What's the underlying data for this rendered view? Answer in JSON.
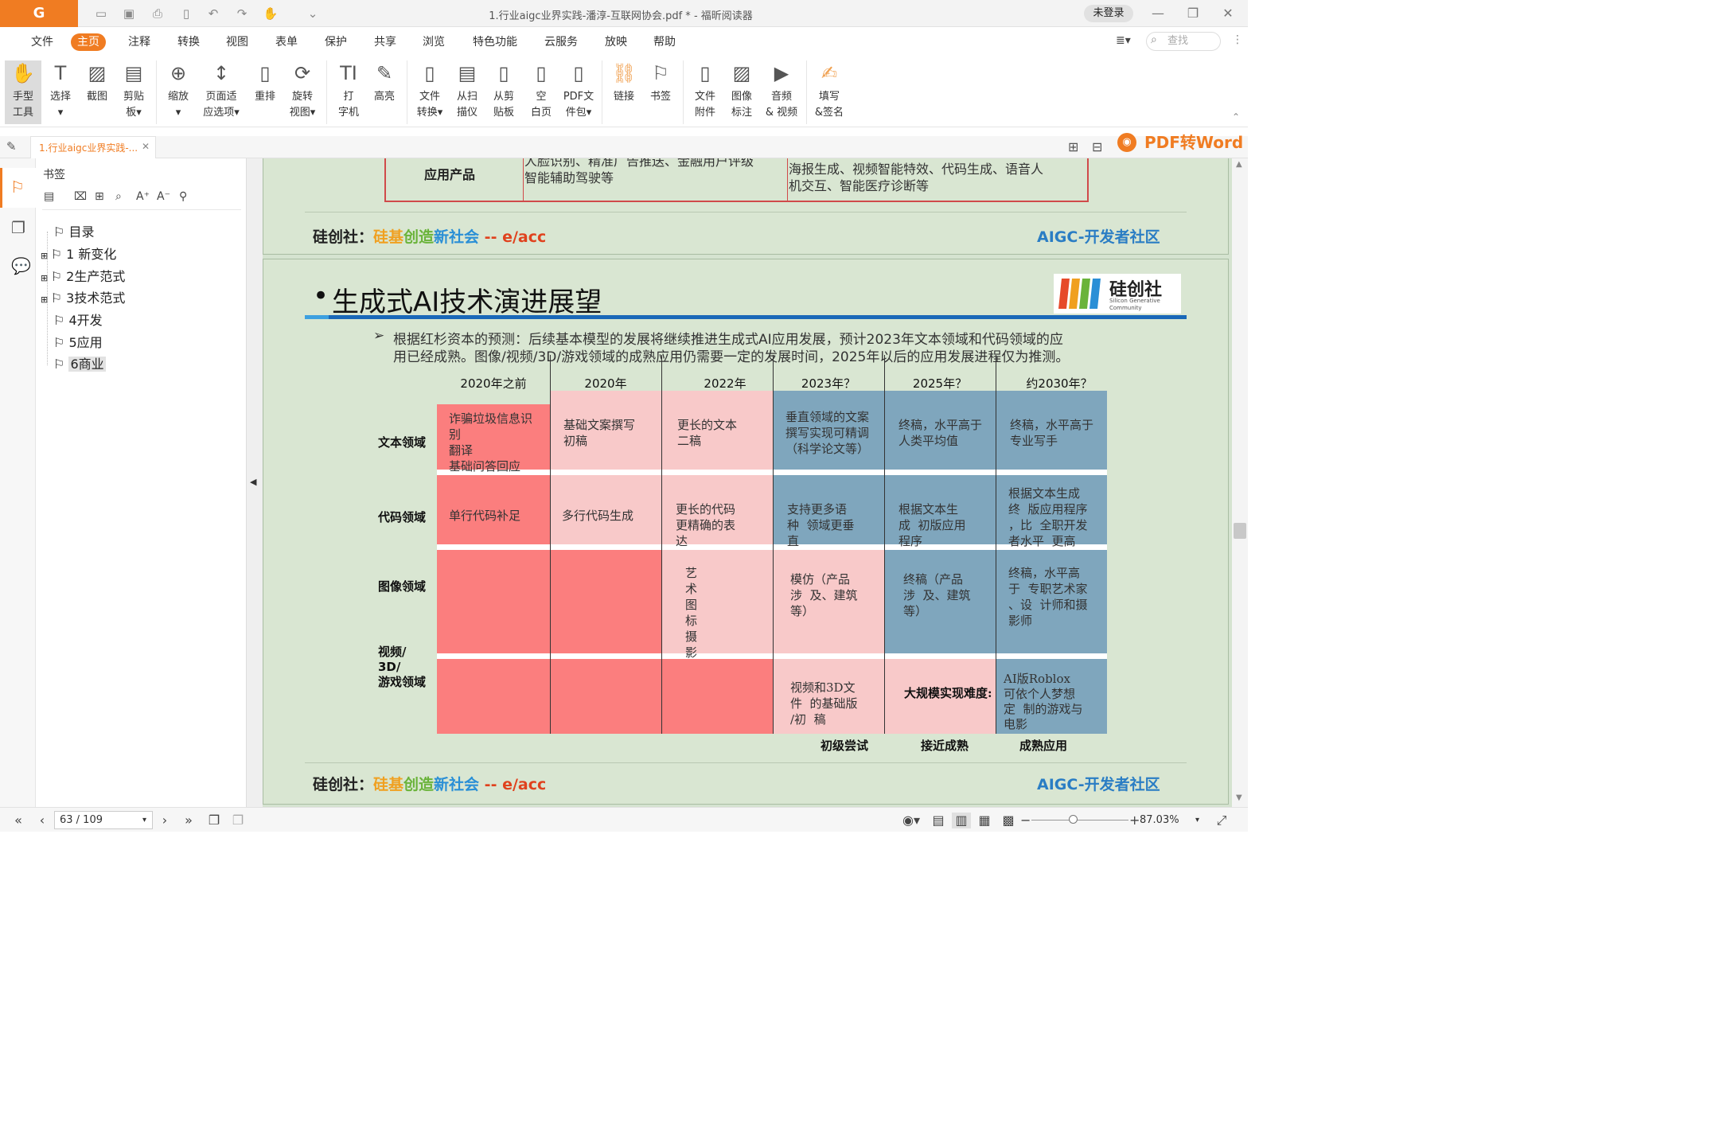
{
  "window": {
    "title": "1.行业aigc业界实践-潘淳-互联网协会.pdf * - 福昕阅读器",
    "login_label": "未登录",
    "logo": "G"
  },
  "menu": [
    "文件",
    "主页",
    "注释",
    "转换",
    "视图",
    "表单",
    "保护",
    "共享",
    "浏览",
    "特色功能",
    "云服务",
    "放映",
    "帮助"
  ],
  "active_menu": "主页",
  "search": {
    "placeholder": "查找"
  },
  "ribbon": [
    {
      "l1": "手型",
      "l2": "工具",
      "icon": "hand-icon"
    },
    {
      "l1": "选择",
      "l2": "▾",
      "icon": "select-text-icon"
    },
    {
      "l1": "截图",
      "l2": "",
      "icon": "screenshot-icon"
    },
    {
      "l1": "剪贴",
      "l2": "板▾",
      "icon": "clipboard-icon"
    },
    {
      "l1": "缩放",
      "l2": "▾",
      "icon": "zoom-icon"
    },
    {
      "l1": "页面适",
      "l2": "应选项▾",
      "icon": "fit-page-icon"
    },
    {
      "l1": "重排",
      "l2": "",
      "icon": "reflow-icon"
    },
    {
      "l1": "旋转",
      "l2": "视图▾",
      "icon": "rotate-icon"
    },
    {
      "l1": "打",
      "l2": "字机",
      "icon": "typewriter-icon"
    },
    {
      "l1": "高亮",
      "l2": "",
      "icon": "highlight-icon"
    },
    {
      "l1": "文件",
      "l2": "转换▾",
      "icon": "file-convert-icon"
    },
    {
      "l1": "从扫",
      "l2": "描仪",
      "icon": "scanner-icon"
    },
    {
      "l1": "从剪",
      "l2": "贴板",
      "icon": "from-clipboard-icon"
    },
    {
      "l1": "空",
      "l2": "白页",
      "icon": "blank-page-icon"
    },
    {
      "l1": "PDF文",
      "l2": "件包▾",
      "icon": "pdf-package-icon"
    },
    {
      "l1": "链接",
      "l2": "",
      "icon": "link-icon"
    },
    {
      "l1": "书签",
      "l2": "",
      "icon": "bookmark-icon"
    },
    {
      "l1": "文件",
      "l2": "附件",
      "icon": "attachment-icon"
    },
    {
      "l1": "图像",
      "l2": "标注",
      "icon": "image-annotation-icon"
    },
    {
      "l1": "音频",
      "l2": "& 视频",
      "icon": "audio-video-icon"
    },
    {
      "l1": "填写",
      "l2": "&签名",
      "icon": "fill-sign-icon"
    }
  ],
  "tab": {
    "label": "1.行业aigc业界实践-..."
  },
  "promo": {
    "label": "PDF转Word"
  },
  "bookmarks": {
    "title": "书签",
    "items": [
      "目录",
      "1 新变化",
      "2生产范式",
      "3技术范式",
      "4开发",
      "5应用",
      "6商业"
    ],
    "selected": "6商业"
  },
  "prev_slide": {
    "row_label": "应用产品",
    "left_text": [
      "人脸识别、精准广告推送、金融用户评级",
      "智能辅助驾驶等"
    ],
    "right_text": [
      "海报生成、视频智能特效、代码生成、语音人",
      "机交互、智能医疗诊断等"
    ],
    "footer_prefix": "硅创社：",
    "footer_slogan": [
      "硅基",
      "创造",
      "新社会"
    ],
    "footer_tail": " -- e/acc",
    "footer_right": "AIGC-开发者社区"
  },
  "slide": {
    "bullet": "•",
    "title": "生成式AI技术演进展望",
    "logo_text": "硅创社",
    "logo_sub": "Silicon Generative Community",
    "intro_arrow": "➢",
    "intro_line1": "根据红杉资本的预测：后续基本模型的发展将继续推进生成式AI应用发展，预计2023年文本领域和代码领域的应",
    "intro_line2": "用已经成熟。图像/视频/3D/游戏领域的成熟应用仍需要一定的发展时间，2025年以后的应用发展进程仅为推测。",
    "columns": [
      "2020年之前",
      "2020年",
      "2022年",
      "2023年？",
      "2025年？",
      "约2030年？"
    ],
    "rows": [
      "文本领域",
      "代码领域",
      "图像领域",
      "视频/\n3D/\n游戏领域"
    ],
    "cells": {
      "text": [
        "诈骗垃圾信息识\n别\n翻译\n基础问答回应",
        "基础文案撰写\n初稿",
        "更长的文本\n二稿",
        "垂直领域的文案\n撰写实现可精调\n（科学论文等）",
        "终稿，水平高于\n人类平均值",
        "终稿，水平高于\n专业写手"
      ],
      "code": [
        "单行代码补足",
        "多行代码生成",
        "更长的代码\n更精确的表\n达",
        "支持更多语\n种  领域更垂\n直",
        "根据文本生\n成  初版应用\n程序",
        "根据文本生成\n终  版应用程序\n，比  全职开发\n者水平  更高"
      ],
      "image": [
        "艺\n术\n图\n标\n摄\n影",
        "模仿（产品\n涉  及、建筑\n等）",
        "终稿（产品\n涉  及、建筑\n等）",
        "终稿，水平高\n于  专职艺术家\n、设  计师和摄\n影师"
      ],
      "video": [
        "视频和3D文\n件  的基础版\n/初  稿",
        "大规模实现难度:",
        "AI版Roblox\n可依个人梦想\n定  制的游戏与\n电影"
      ]
    },
    "legend": [
      "初级尝试",
      "接近成熟",
      "成熟应用"
    ],
    "colors": {
      "early": "#fb7e7e",
      "near": "#f8c9c9",
      "mature": "#7fa6bd"
    },
    "footer_prefix": "硅创社：",
    "footer_slogan": [
      "硅基",
      "创造",
      "新社会"
    ],
    "footer_tail": " -- e/acc",
    "footer_right": "AIGC-开发者社区"
  },
  "status": {
    "page": "63 / 109",
    "zoom": "87.03%"
  }
}
